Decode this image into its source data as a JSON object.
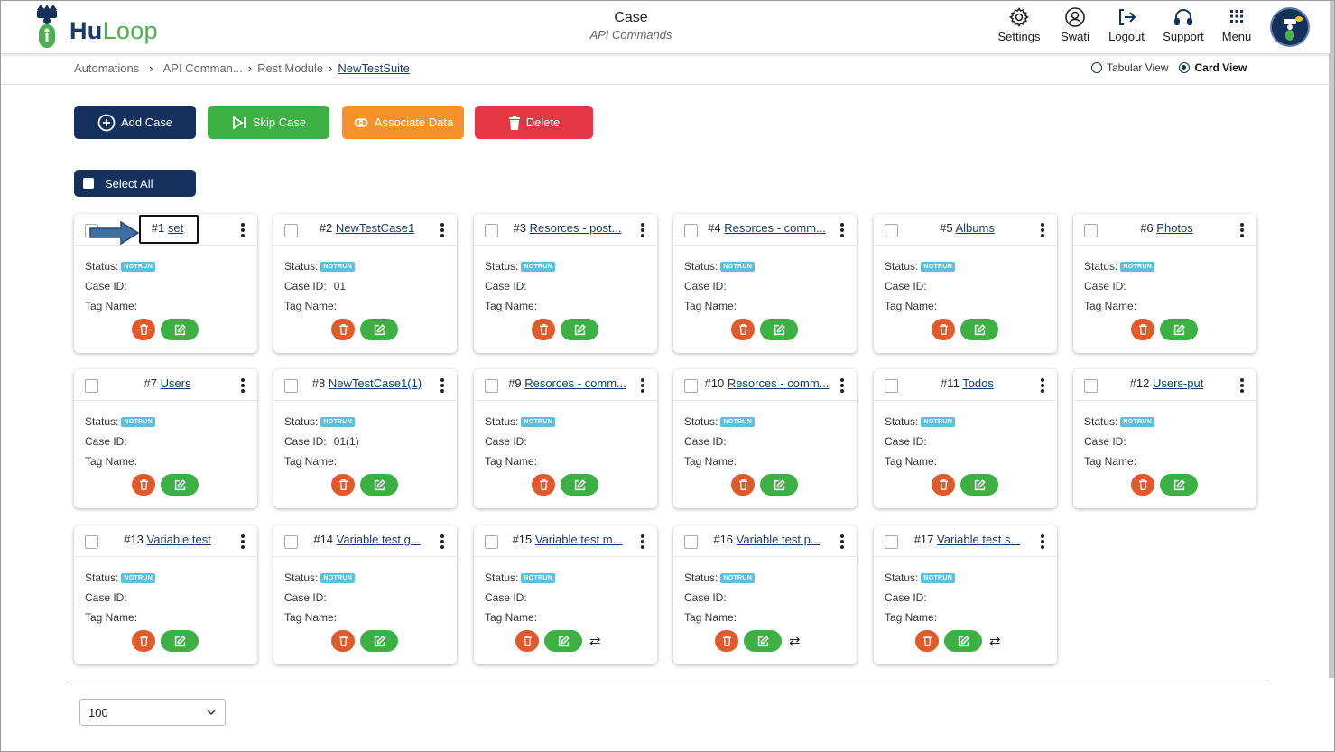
{
  "app": {
    "logo_main": "Hu",
    "logo_accent": "Loop"
  },
  "header": {
    "title": "Case",
    "subtitle": "API Commands",
    "nav": [
      {
        "label": "Settings",
        "icon": "gear-icon"
      },
      {
        "label": "Swati",
        "icon": "user-icon"
      },
      {
        "label": "Logout",
        "icon": "logout-icon"
      },
      {
        "label": "Support",
        "icon": "headset-icon"
      },
      {
        "label": "Menu",
        "icon": "grid-icon"
      }
    ]
  },
  "breadcrumb": {
    "items": [
      "Automations",
      "API Comman...",
      "Rest Module",
      "NewTestSuite"
    ]
  },
  "view_options": {
    "tabular": "Tabular View",
    "card": "Card View",
    "selected": "Card View"
  },
  "actions": {
    "add": "Add Case",
    "skip": "Skip Case",
    "associate": "Associate Data",
    "delete": "Delete"
  },
  "select_all": "Select All",
  "labels": {
    "status": "Status:",
    "case_id": "Case ID:",
    "tag_name": "Tag Name:"
  },
  "colors": {
    "primary": "#13315c",
    "green": "#3cb043",
    "orange": "#f5922b",
    "red": "#e53645",
    "badge": "#5bc0de",
    "delete_icon_bg": "#e05a2b"
  },
  "cases": [
    {
      "num": "#1",
      "name": "set",
      "status": "NOTRUN",
      "case_id": "",
      "tag": "",
      "swap": false
    },
    {
      "num": "#2",
      "name": "NewTestCase1",
      "status": "NOTRUN",
      "case_id": "01",
      "tag": "",
      "swap": false
    },
    {
      "num": "#3",
      "name": "Resorces - post...",
      "status": "NOTRUN",
      "case_id": "",
      "tag": "",
      "swap": false
    },
    {
      "num": "#4",
      "name": "Resorces - comm...",
      "status": "NOTRUN",
      "case_id": "",
      "tag": "",
      "swap": false
    },
    {
      "num": "#5",
      "name": "Albums",
      "status": "NOTRUN",
      "case_id": "",
      "tag": "",
      "swap": false
    },
    {
      "num": "#6",
      "name": "Photos",
      "status": "NOTRUN",
      "case_id": "",
      "tag": "",
      "swap": false
    },
    {
      "num": "#7",
      "name": "Users",
      "status": "NOTRUN",
      "case_id": "",
      "tag": "",
      "swap": false
    },
    {
      "num": "#8",
      "name": "NewTestCase1(1)",
      "status": "NOTRUN",
      "case_id": "01(1)",
      "tag": "",
      "swap": false
    },
    {
      "num": "#9",
      "name": "Resorces - comm...",
      "status": "NOTRUN",
      "case_id": "",
      "tag": "",
      "swap": false
    },
    {
      "num": "#10",
      "name": "Resorces - comm...",
      "status": "NOTRUN",
      "case_id": "",
      "tag": "",
      "swap": false
    },
    {
      "num": "#11",
      "name": "Todos",
      "status": "NOTRUN",
      "case_id": "",
      "tag": "",
      "swap": false
    },
    {
      "num": "#12",
      "name": "Users-put",
      "status": "NOTRUN",
      "case_id": "",
      "tag": "",
      "swap": false
    },
    {
      "num": "#13",
      "name": "Variable test",
      "status": "NOTRUN",
      "case_id": "",
      "tag": "",
      "swap": false
    },
    {
      "num": "#14",
      "name": "Variable test g...",
      "status": "NOTRUN",
      "case_id": "",
      "tag": "",
      "swap": false
    },
    {
      "num": "#15",
      "name": "Variable test m...",
      "status": "NOTRUN",
      "case_id": "",
      "tag": "",
      "swap": true
    },
    {
      "num": "#16",
      "name": "Variable test p...",
      "status": "NOTRUN",
      "case_id": "",
      "tag": "",
      "swap": true
    },
    {
      "num": "#17",
      "name": "Variable test s...",
      "status": "NOTRUN",
      "case_id": "",
      "tag": "",
      "swap": true
    }
  ],
  "pagination": {
    "page_size": "100"
  }
}
